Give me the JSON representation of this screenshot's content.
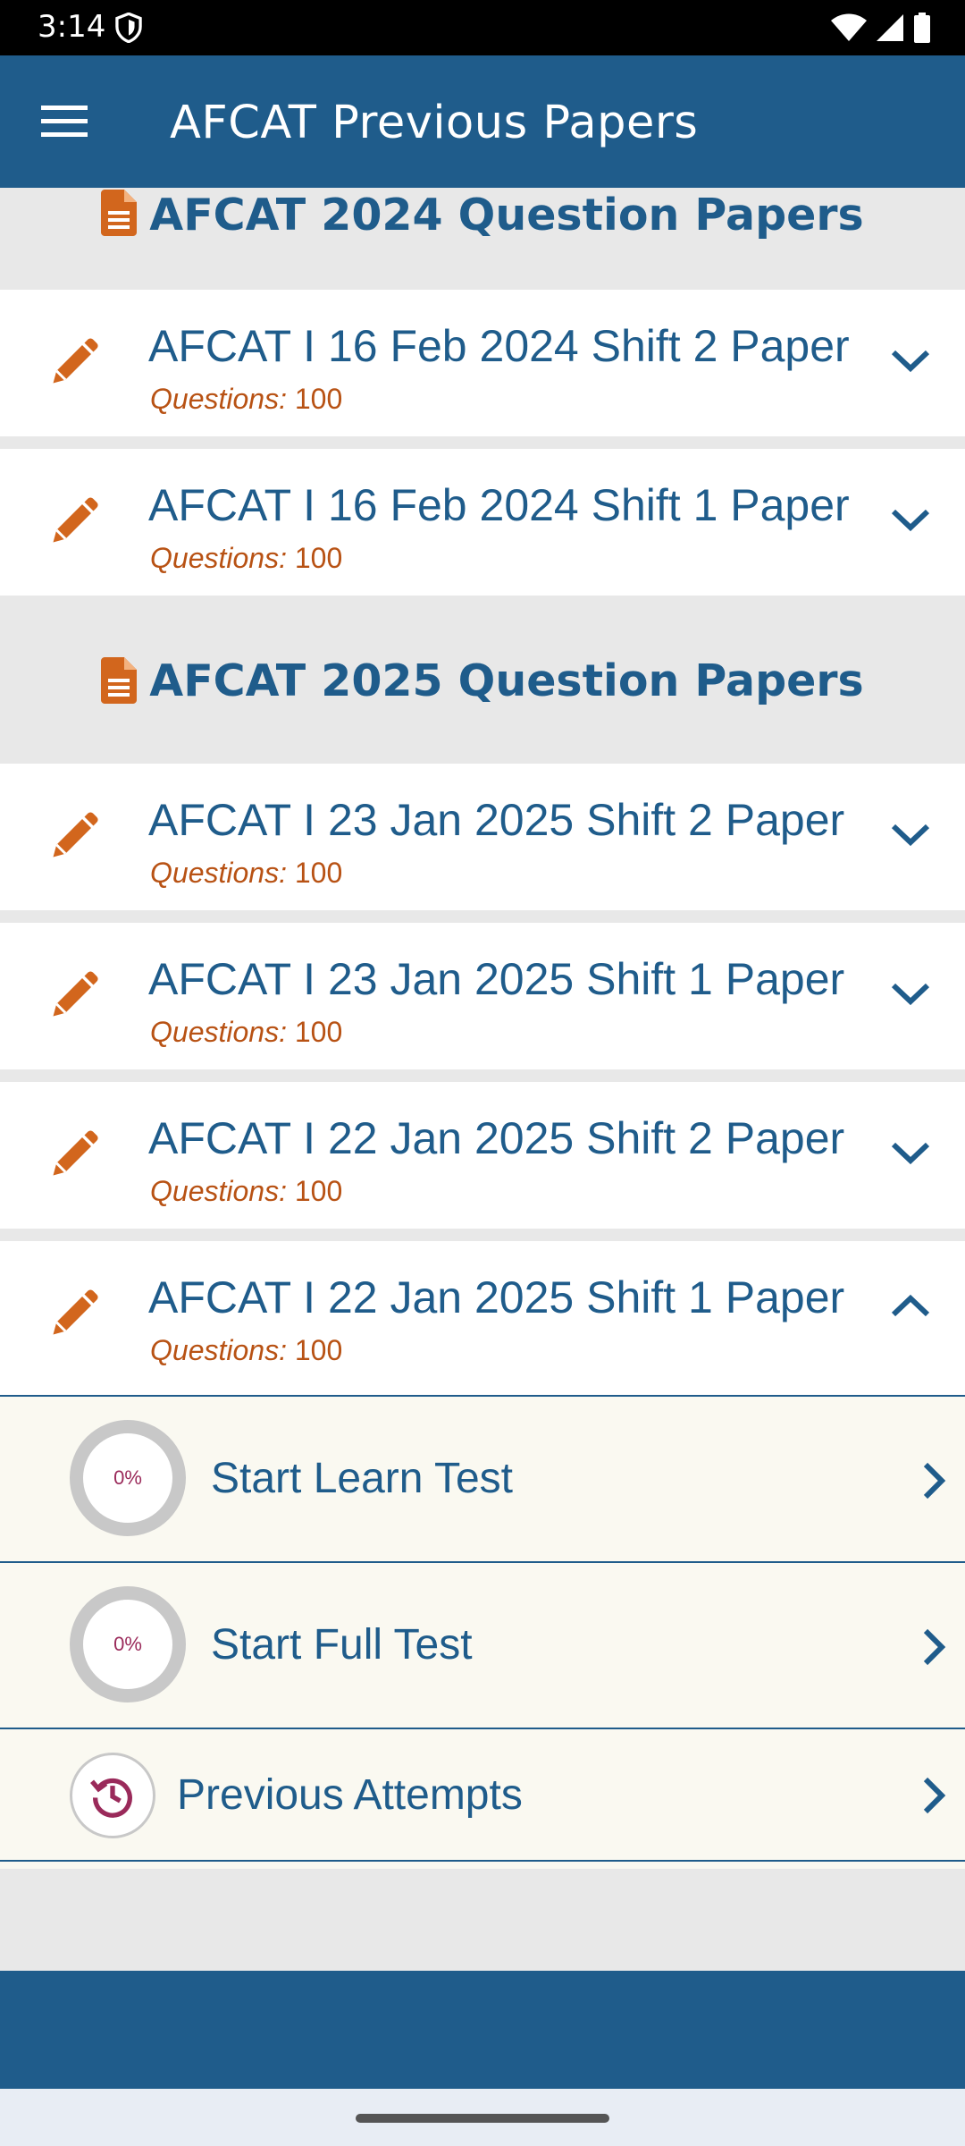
{
  "status_bar": {
    "time": "3:14"
  },
  "app_bar": {
    "title": "AFCAT Previous Papers"
  },
  "sections": {
    "s2024": {
      "title": "AFCAT 2024 Question Papers"
    },
    "s2025": {
      "title": "AFCAT 2025 Question Papers"
    }
  },
  "questions_label": "Questions:",
  "papers_2024": [
    {
      "title": "AFCAT I 16 Feb 2024 Shift 2 Paper",
      "questions": "100"
    },
    {
      "title": "AFCAT I 16 Feb 2024 Shift 1 Paper",
      "questions": "100"
    }
  ],
  "papers_2025": [
    {
      "title": "AFCAT I 23 Jan 2025 Shift 2 Paper",
      "questions": "100"
    },
    {
      "title": "AFCAT I 23 Jan 2025 Shift 1 Paper",
      "questions": "100"
    },
    {
      "title": "AFCAT I 22 Jan 2025 Shift 2 Paper",
      "questions": "100"
    },
    {
      "title": "AFCAT I 22 Jan 2025 Shift 1 Paper",
      "questions": "100"
    }
  ],
  "expanded_options": {
    "learn": {
      "label": "Start Learn Test",
      "progress": "0%"
    },
    "full": {
      "label": "Start Full Test",
      "progress": "0%"
    },
    "history": {
      "label": "Previous Attempts"
    }
  },
  "colors": {
    "primary": "#1f5c8b",
    "accent": "#d2661d",
    "question_text": "#b85214",
    "progress_text": "#9a2a5a",
    "panel_bg": "#faf9f1"
  },
  "icons": {
    "menu": "hamburger-icon",
    "document": "document-icon",
    "edit": "pencil-icon",
    "expand": "chevron-down-icon",
    "collapse": "chevron-up-icon",
    "go": "chevron-right-icon",
    "history": "history-icon"
  }
}
